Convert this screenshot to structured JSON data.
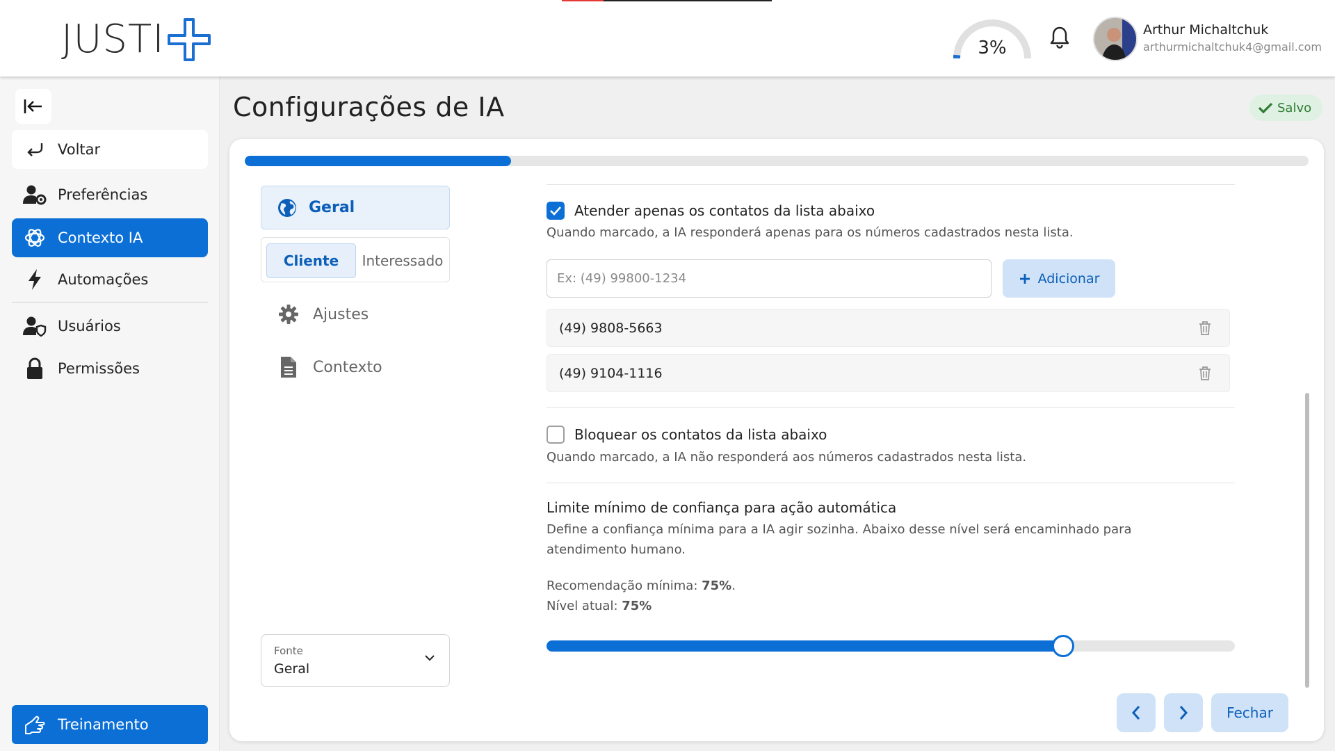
{
  "header": {
    "logo_text": "JUSTI",
    "usage_percent": 3,
    "usage_label": "3%",
    "user": {
      "name": "Arthur Michaltchuk",
      "email": "arthurmichaltchuk4@gmail.com"
    }
  },
  "sidebar": {
    "items": [
      {
        "label": "Voltar",
        "icon": "return-arrow-icon"
      },
      {
        "label": "Preferências",
        "icon": "user-gear-icon"
      },
      {
        "label": "Contexto IA",
        "icon": "ai-swirl-icon",
        "active": true
      },
      {
        "label": "Automações",
        "icon": "lightning-icon"
      },
      {
        "label": "Usuários",
        "icon": "user-shield-icon"
      },
      {
        "label": "Permissões",
        "icon": "lock-icon"
      }
    ],
    "training_label": "Treinamento"
  },
  "page": {
    "title": "Configurações de IA",
    "saved_label": "Salvo",
    "progress_percent": 25
  },
  "tabs": {
    "general_label": "Geral",
    "segment": {
      "client_label": "Cliente",
      "prospect_label": "Interessado"
    },
    "menu": [
      {
        "label": "Ajustes",
        "icon": "gear-icon"
      },
      {
        "label": "Contexto",
        "icon": "document-icon"
      }
    ]
  },
  "source_select": {
    "label": "Fonte",
    "value": "Geral"
  },
  "allowlist": {
    "checked": true,
    "title": "Atender apenas os contatos da lista abaixo",
    "description": "Quando marcado, a IA responderá apenas para os números cadastrados nesta lista.",
    "input_placeholder": "Ex: (49) 99800-1234",
    "add_label": "Adicionar",
    "numbers": [
      "(49) 9808-5663",
      "(49) 9104-1116"
    ]
  },
  "blocklist": {
    "checked": false,
    "title": "Bloquear os contatos da lista abaixo",
    "description": "Quando marcado, a IA não responderá aos números cadastrados nesta lista."
  },
  "confidence": {
    "title": "Limite mínimo de confiança para ação automática",
    "description_line1": "Define a confiança mínima para a IA agir sozinha. Abaixo desse nível será encaminhado para",
    "description_line2": "atendimento humano.",
    "recommendation_label": "Recomendação mínima: ",
    "recommendation_value": "75%",
    "current_label": "Nível atual: ",
    "current_value": "75%",
    "level_percent": 75
  },
  "footer": {
    "close_label": "Fechar"
  },
  "colors": {
    "primary": "#0b6fd6",
    "primary_light": "#cfe2f7",
    "success": "#2e7d32"
  }
}
